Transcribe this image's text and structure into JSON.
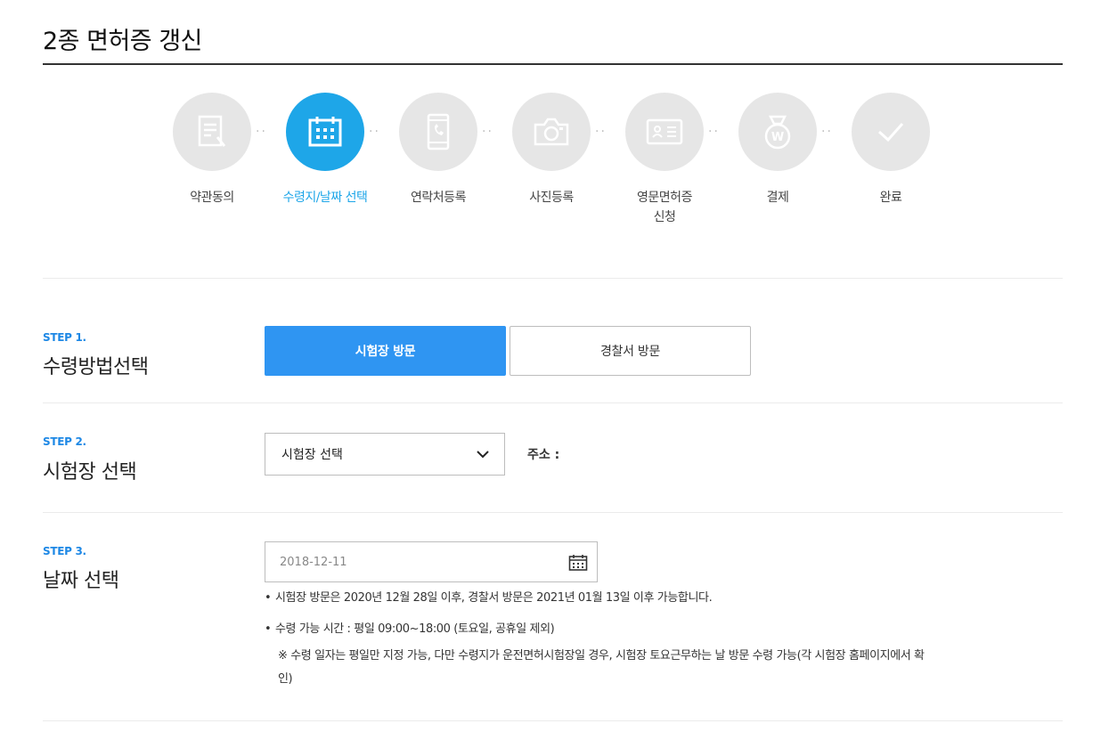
{
  "page": {
    "title": "2종 면허증 갱신"
  },
  "steps": [
    {
      "label": "약관동의",
      "icon": "document-icon",
      "active": false
    },
    {
      "label": "수령지/날짜 선택",
      "icon": "calendar-icon",
      "active": true
    },
    {
      "label": "연락처등록",
      "icon": "mobile-phone-icon",
      "active": false
    },
    {
      "label": "사진등록",
      "icon": "camera-icon",
      "active": false
    },
    {
      "label": "영문면허증",
      "label2": "신청",
      "icon": "id-card-icon",
      "active": false
    },
    {
      "label": "결제",
      "icon": "won-bag-icon",
      "active": false
    },
    {
      "label": "완료",
      "icon": "check-icon",
      "active": false
    }
  ],
  "step1": {
    "tag": "STEP 1.",
    "title": "수령방법선택",
    "options": [
      "시험장 방문",
      "경찰서 방문"
    ],
    "selected": "시험장 방문"
  },
  "step2": {
    "tag": "STEP 2.",
    "title": "시험장 선택",
    "select_value": "시험장 선택",
    "address_label": "주소 :",
    "address_value": ""
  },
  "step3": {
    "tag": "STEP 3.",
    "title": "날짜 선택",
    "date_value": "2018-12-11",
    "notes": [
      "시험장 방문은 2020년 12월 28일 이후, 경찰서 방문은 2021년 01월 13일 이후 가능합니다.",
      "수령 가능 시간 : 평일 09:00~18:00 (토요일, 공휴일 제외)"
    ],
    "remark_line1": "※ 수령 일자는 평일만 지정 가능, 다만 수령지가 운전면허시험장일 경우, 시험장 토요근무하는 날 방문 수령 가능(각 시험장 홈페이지에서 확",
    "remark_line2": "인)"
  },
  "colors": {
    "accent": "#1ea6e8",
    "primary_button": "#2f95f2",
    "step_tag": "#1e88e5",
    "inactive_circle": "#e6e6e6"
  }
}
